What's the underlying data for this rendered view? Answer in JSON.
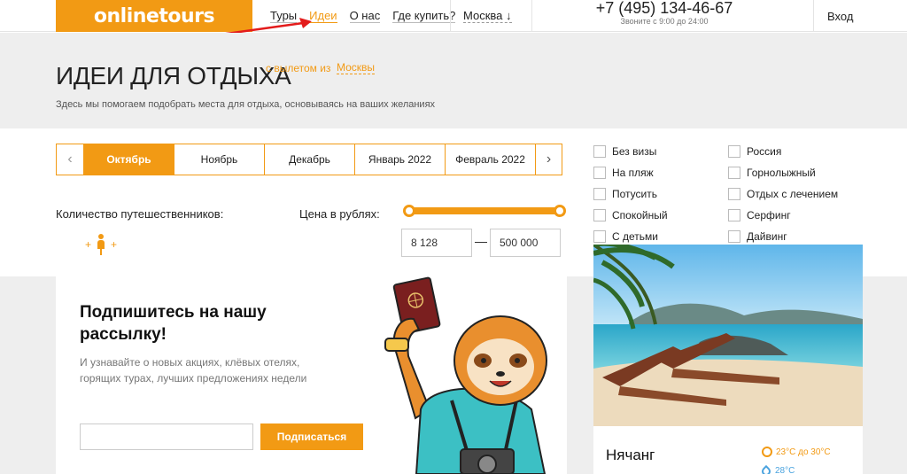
{
  "header": {
    "logo": "onlinetours",
    "nav": [
      "Туры",
      "Идеи",
      "О нас",
      "Где купить?"
    ],
    "active_nav": "Идеи",
    "city": "Москва ↓",
    "phone": "+7 (495) 134-46-67",
    "hours": "Звоните с 9:00 до 24:00",
    "login": "Вход"
  },
  "hero": {
    "title": "ИДЕИ ДЛЯ ОТДЫХА",
    "from_label": "с вылетом из",
    "from_city": "Москвы",
    "subtitle": "Здесь мы помогаем подобрать места для отдыха, основываясь на ваших желаниях"
  },
  "months": {
    "items": [
      "Октябрь",
      "Ноябрь",
      "Декабрь",
      "Январь 2022",
      "Февраль 2022"
    ],
    "selected": "Октябрь",
    "prev_icon": "chevron-left-icon",
    "next_icon": "chevron-right-icon"
  },
  "travelers": {
    "label": "Количество путешественников:",
    "count": 1
  },
  "price": {
    "label": "Цена в рублях:",
    "min": "8 128",
    "max": "500 000"
  },
  "filters": {
    "left": [
      "Без визы",
      "На пляж",
      "Потусить",
      "Спокойный",
      "С детьми"
    ],
    "right": [
      "Россия",
      "Горнолыжный",
      "Отдых с лечением",
      "Серфинг",
      "Дайвинг"
    ]
  },
  "subscribe": {
    "title": "Подпишитесь на нашу рассылку!",
    "text": "И узнавайте о новых акциях, клёвых отелях, горящих турах, лучших предложениях недели",
    "email_placeholder": "",
    "button": "Подписаться"
  },
  "destination": {
    "name": "Нячанг",
    "air_temp": "23°C до 30°C",
    "water_temp": "28°C"
  },
  "colors": {
    "accent": "#f29a14",
    "hero_bg": "#eeeeee",
    "annotation": "#e31b1b"
  }
}
